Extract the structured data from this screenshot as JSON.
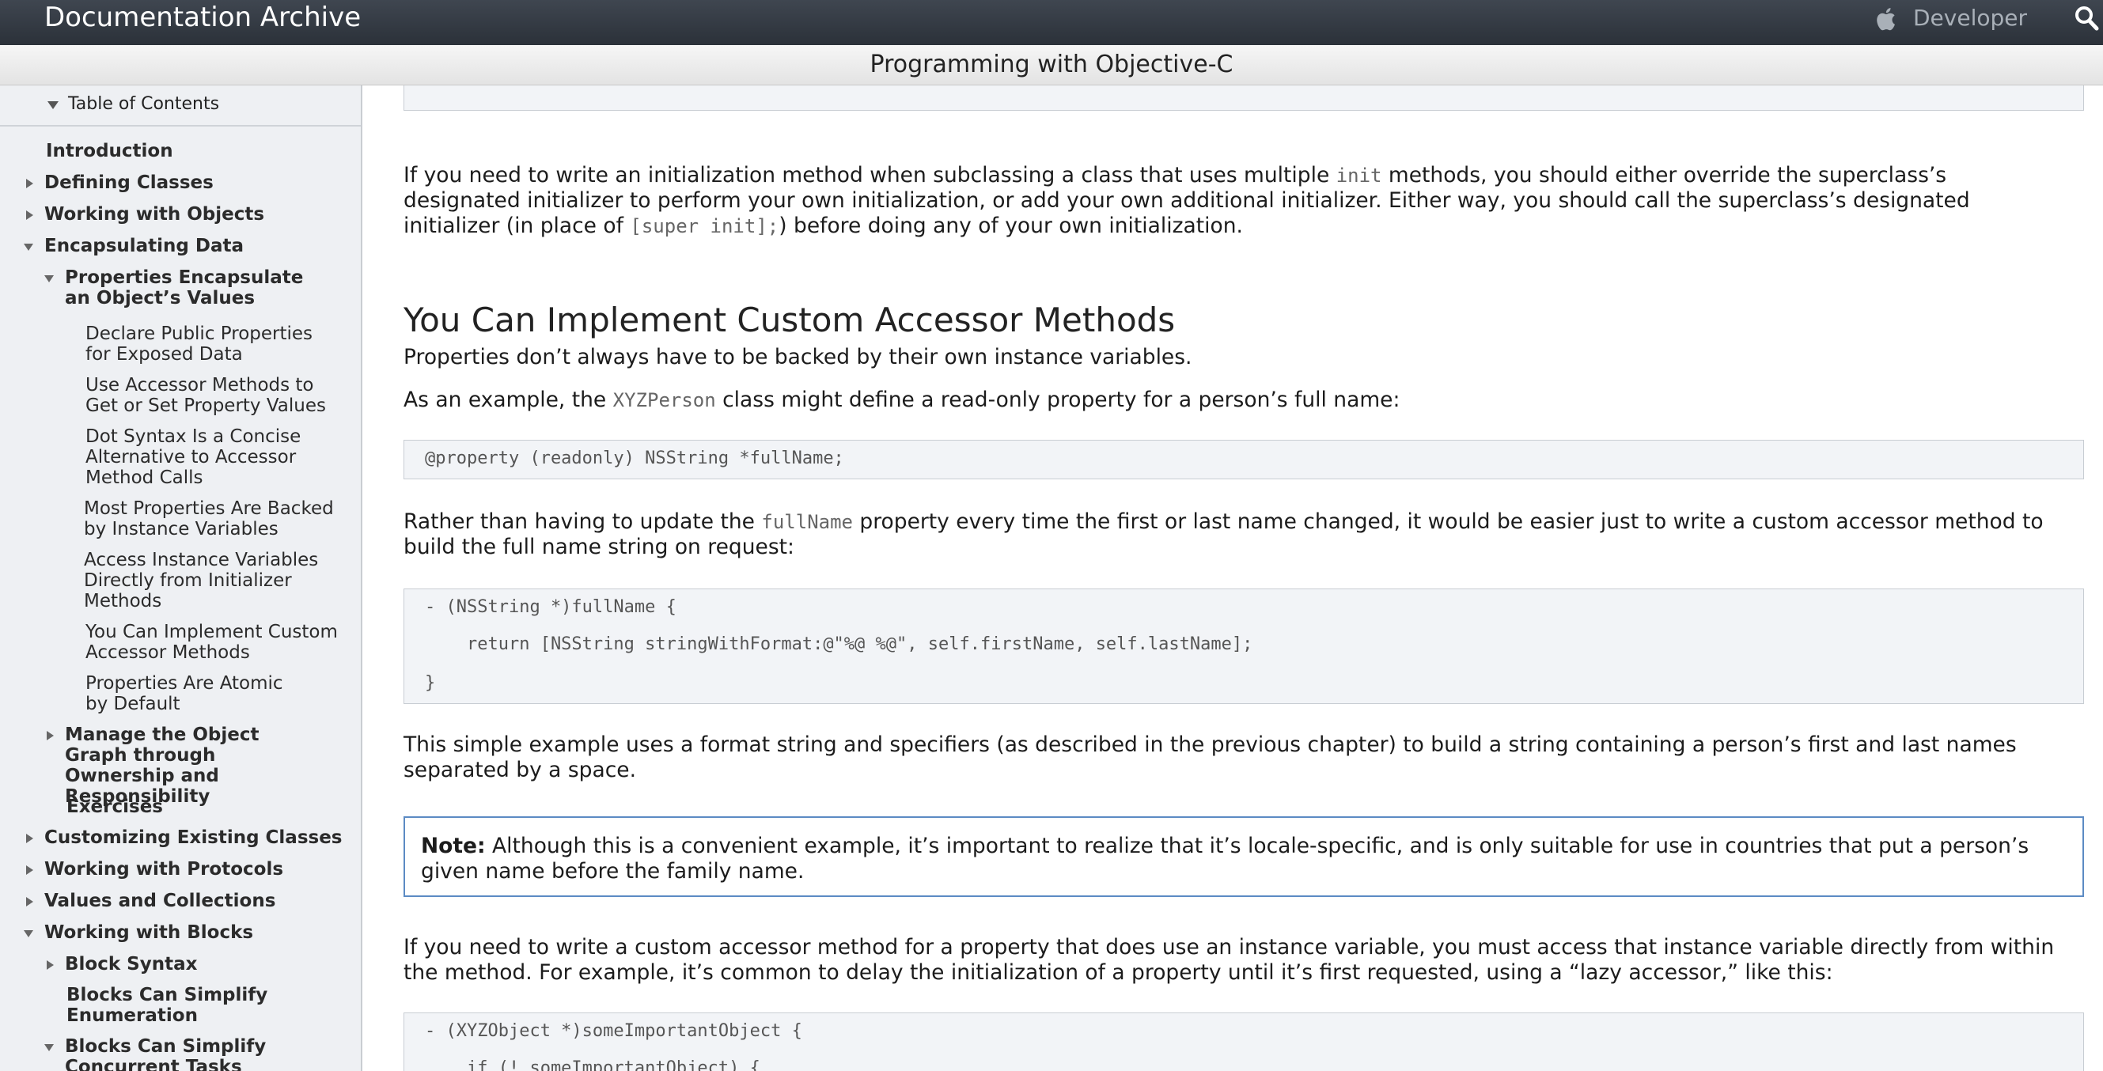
{
  "header": {
    "site_title": "Documentation Archive",
    "developer_link": "Developer",
    "apple_icon": "apple-logo-icon",
    "search_icon": "search-icon"
  },
  "doc": {
    "title": "Programming with Objective-C"
  },
  "sidebar": {
    "toc_title": "Table of Contents",
    "items": [
      {
        "label": "Introduction",
        "state": "none"
      },
      {
        "label": "Defining Classes",
        "state": "collapsed"
      },
      {
        "label": "Working with Objects",
        "state": "collapsed"
      },
      {
        "label": "Encapsulating Data",
        "state": "expanded"
      },
      {
        "label": "Properties Encapsulate an Object’s Values",
        "state": "expanded"
      },
      {
        "label": "Declare Public Properties for Exposed Data",
        "state": "none"
      },
      {
        "label": "Use Accessor Methods to Get or Set Property Values",
        "state": "none"
      },
      {
        "label": "Dot Syntax Is a Concise Alternative to Accessor Method Calls",
        "state": "none"
      },
      {
        "label": "Most Properties Are Backed by Instance Variables",
        "state": "none"
      },
      {
        "label": "Access Instance Variables Directly from Initializer Methods",
        "state": "none"
      },
      {
        "label": "You Can Implement Custom Accessor Methods",
        "state": "none"
      },
      {
        "label": "Properties Are Atomic by Default",
        "state": "none"
      },
      {
        "label": "Manage the Object Graph through Ownership and Responsibility",
        "state": "collapsed"
      },
      {
        "label": "Exercises",
        "state": "none"
      },
      {
        "label": "Customizing Existing Classes",
        "state": "collapsed"
      },
      {
        "label": "Working with Protocols",
        "state": "collapsed"
      },
      {
        "label": "Values and Collections",
        "state": "collapsed"
      },
      {
        "label": "Working with Blocks",
        "state": "expanded"
      },
      {
        "label": "Block Syntax",
        "state": "collapsed"
      },
      {
        "label": "Blocks Can Simplify Enumeration",
        "state": "none"
      },
      {
        "label": "Blocks Can Simplify Concurrent Tasks",
        "state": "expanded"
      }
    ]
  },
  "content": {
    "p1": {
      "t1": "If you need to write an initialization method when subclassing a class that uses multiple ",
      "c1": "init",
      "t2": " methods, you should either override the superclass’s designated initializer to perform your own initialization, or add your own additional initializer. Either way, you should call the superclass’s designated initializer (in place of ",
      "c2": "[super init];",
      "t3": ") before doing any of your own initialization."
    },
    "heading": "You Can Implement Custom Accessor Methods",
    "p2": "Properties don’t always have to be backed by their own instance variables.",
    "p3": {
      "t1": "As an example, the ",
      "c1": "XYZPerson",
      "t2": " class might define a read-only property for a person’s full name:"
    },
    "code1": [
      "@property (readonly) NSString *fullName;"
    ],
    "p4": {
      "t1": "Rather than having to update the ",
      "c1": "fullName",
      "t2": " property every time the first or last name changed, it would be easier just to write a custom accessor method to build the full name string on request:"
    },
    "code2": [
      "- (NSString *)fullName {",
      "    return [NSString stringWithFormat:@\"%@ %@\", self.firstName, self.lastName];",
      "}"
    ],
    "p5": "This simple example uses a format string and specifiers (as described in the previous chapter) to build a string containing a person’s first and last names separated by a space.",
    "note": {
      "label": "Note:",
      "text": " Although this is a convenient example, it’s important to realize that it’s locale-specific, and is only suitable for use in countries that put a person’s given name before the family name."
    },
    "p6": "If you need to write a custom accessor method for a property that does use an instance variable, you must access that instance variable directly from within the method. For example, it’s common to delay the initialization of a property until it’s first requested, using a “lazy accessor,” like this:",
    "code3": [
      "- (XYZObject *)someImportantObject {",
      "    if (!_someImportantObject) {"
    ]
  }
}
